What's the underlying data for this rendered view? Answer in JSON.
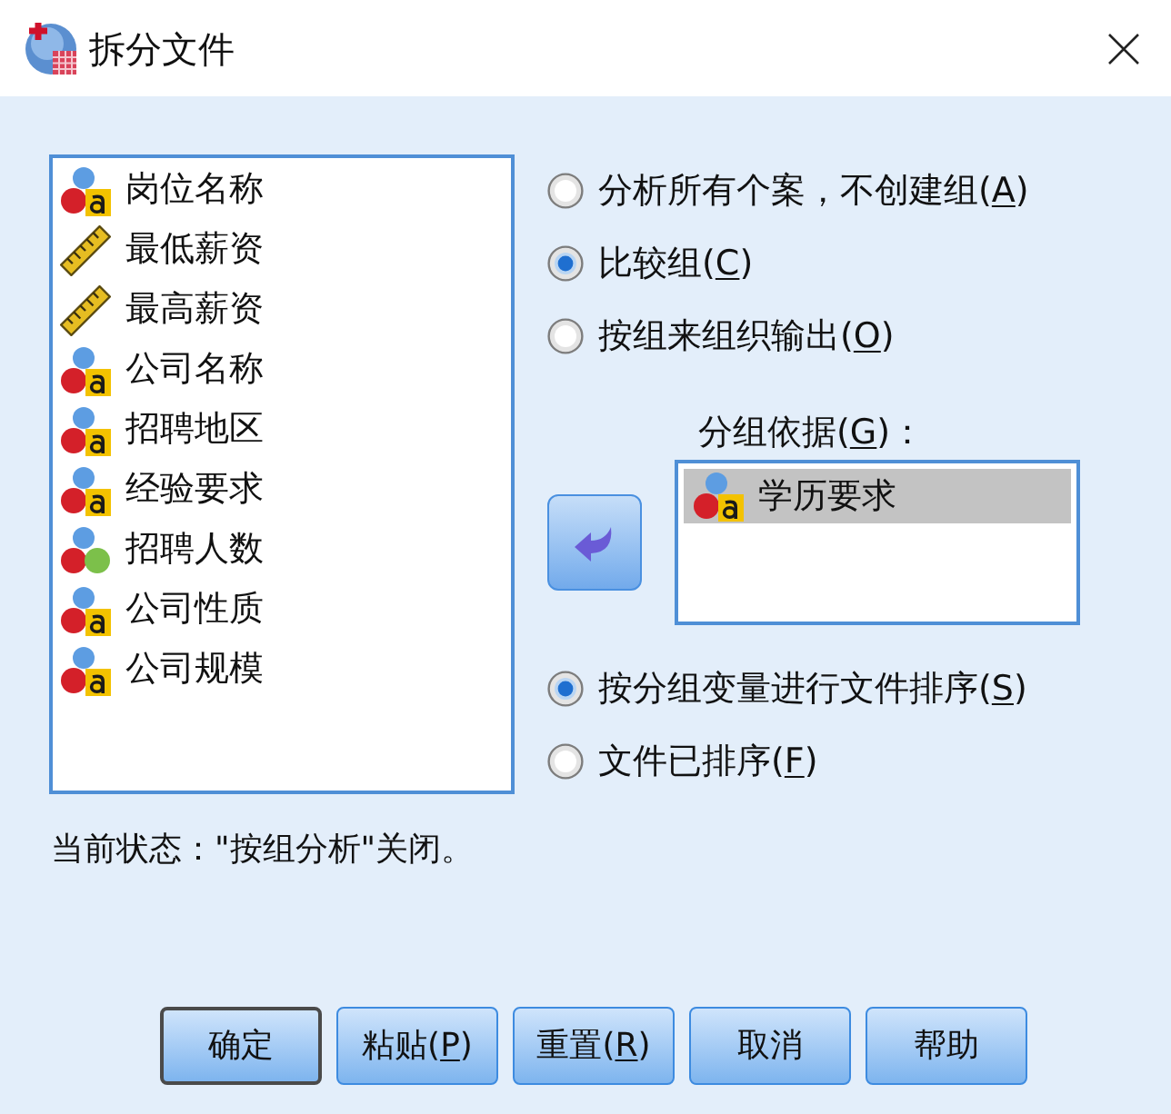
{
  "window": {
    "title": "拆分文件"
  },
  "variables": [
    {
      "name": "岗位名称",
      "kind": "nominal_string"
    },
    {
      "name": "最低薪资",
      "kind": "scale"
    },
    {
      "name": "最高薪资",
      "kind": "scale"
    },
    {
      "name": "公司名称",
      "kind": "nominal_string"
    },
    {
      "name": "招聘地区",
      "kind": "nominal_string"
    },
    {
      "name": "经验要求",
      "kind": "nominal_string"
    },
    {
      "name": "招聘人数",
      "kind": "nominal"
    },
    {
      "name": "公司性质",
      "kind": "nominal_string"
    },
    {
      "name": "公司规模",
      "kind": "nominal_string"
    }
  ],
  "options": [
    {
      "label": "分析所有个案，不创建组(",
      "access_key": "A",
      "label_end": ")",
      "selected": false
    },
    {
      "label": "比较组(",
      "access_key": "C",
      "label_end": ")",
      "selected": true
    },
    {
      "label": "按组来组织输出(",
      "access_key": "O",
      "label_end": ")",
      "selected": false
    }
  ],
  "group_by": {
    "label": "分组依据(",
    "access_key": "G",
    "label_end": ")：",
    "items": [
      {
        "name": "学历要求",
        "kind": "nominal_string",
        "selected": true
      }
    ]
  },
  "sort_options": [
    {
      "label": "按分组变量进行文件排序(",
      "access_key": "S",
      "label_end": ")",
      "selected": true
    },
    {
      "label": "文件已排序(",
      "access_key": "F",
      "label_end": ")",
      "selected": false
    }
  ],
  "status": "当前状态：\"按组分析\"关闭。",
  "buttons": [
    {
      "label": "确定",
      "default": true
    },
    {
      "label": "粘贴(",
      "access_key": "P",
      "label_end": ")",
      "default": false
    },
    {
      "label": "重置(",
      "access_key": "R",
      "label_end": ")",
      "default": false
    },
    {
      "label": "取消",
      "default": false
    },
    {
      "label": "帮助",
      "default": false
    }
  ]
}
